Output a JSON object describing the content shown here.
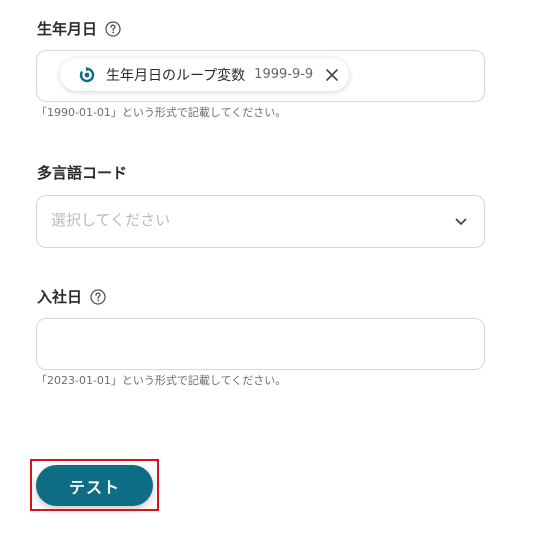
{
  "fields": {
    "birthdate": {
      "label": "生年月日",
      "chip": {
        "label": "生年月日のループ変数",
        "value": "1999-9-9"
      },
      "hint": "「1990-01-01」という形式で記載してください。"
    },
    "language_code": {
      "label": "多言語コード",
      "placeholder": "選択してください"
    },
    "join_date": {
      "label": "入社日",
      "value": "",
      "hint": "「2023-01-01」という形式で記載してください。"
    }
  },
  "actions": {
    "test_label": "テスト"
  },
  "colors": {
    "accent": "#0c6d85",
    "highlight": "#d9131b"
  }
}
